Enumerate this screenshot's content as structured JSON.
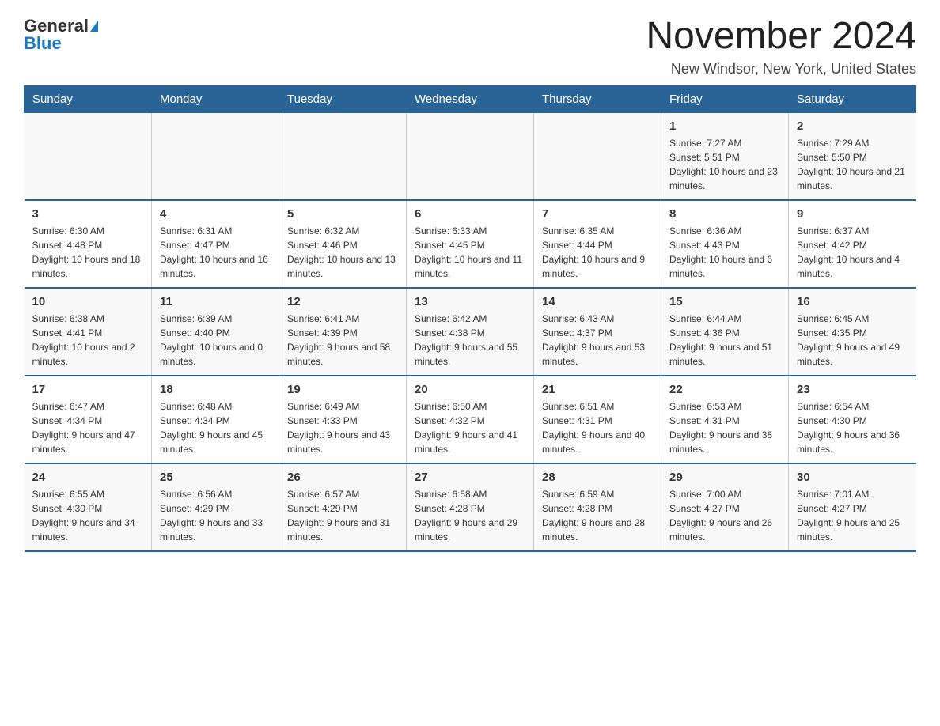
{
  "logo": {
    "general": "General",
    "blue": "Blue"
  },
  "title": "November 2024",
  "location": "New Windsor, New York, United States",
  "days_of_week": [
    "Sunday",
    "Monday",
    "Tuesday",
    "Wednesday",
    "Thursday",
    "Friday",
    "Saturday"
  ],
  "weeks": [
    [
      {
        "day": "",
        "info": ""
      },
      {
        "day": "",
        "info": ""
      },
      {
        "day": "",
        "info": ""
      },
      {
        "day": "",
        "info": ""
      },
      {
        "day": "",
        "info": ""
      },
      {
        "day": "1",
        "info": "Sunrise: 7:27 AM\nSunset: 5:51 PM\nDaylight: 10 hours and 23 minutes."
      },
      {
        "day": "2",
        "info": "Sunrise: 7:29 AM\nSunset: 5:50 PM\nDaylight: 10 hours and 21 minutes."
      }
    ],
    [
      {
        "day": "3",
        "info": "Sunrise: 6:30 AM\nSunset: 4:48 PM\nDaylight: 10 hours and 18 minutes."
      },
      {
        "day": "4",
        "info": "Sunrise: 6:31 AM\nSunset: 4:47 PM\nDaylight: 10 hours and 16 minutes."
      },
      {
        "day": "5",
        "info": "Sunrise: 6:32 AM\nSunset: 4:46 PM\nDaylight: 10 hours and 13 minutes."
      },
      {
        "day": "6",
        "info": "Sunrise: 6:33 AM\nSunset: 4:45 PM\nDaylight: 10 hours and 11 minutes."
      },
      {
        "day": "7",
        "info": "Sunrise: 6:35 AM\nSunset: 4:44 PM\nDaylight: 10 hours and 9 minutes."
      },
      {
        "day": "8",
        "info": "Sunrise: 6:36 AM\nSunset: 4:43 PM\nDaylight: 10 hours and 6 minutes."
      },
      {
        "day": "9",
        "info": "Sunrise: 6:37 AM\nSunset: 4:42 PM\nDaylight: 10 hours and 4 minutes."
      }
    ],
    [
      {
        "day": "10",
        "info": "Sunrise: 6:38 AM\nSunset: 4:41 PM\nDaylight: 10 hours and 2 minutes."
      },
      {
        "day": "11",
        "info": "Sunrise: 6:39 AM\nSunset: 4:40 PM\nDaylight: 10 hours and 0 minutes."
      },
      {
        "day": "12",
        "info": "Sunrise: 6:41 AM\nSunset: 4:39 PM\nDaylight: 9 hours and 58 minutes."
      },
      {
        "day": "13",
        "info": "Sunrise: 6:42 AM\nSunset: 4:38 PM\nDaylight: 9 hours and 55 minutes."
      },
      {
        "day": "14",
        "info": "Sunrise: 6:43 AM\nSunset: 4:37 PM\nDaylight: 9 hours and 53 minutes."
      },
      {
        "day": "15",
        "info": "Sunrise: 6:44 AM\nSunset: 4:36 PM\nDaylight: 9 hours and 51 minutes."
      },
      {
        "day": "16",
        "info": "Sunrise: 6:45 AM\nSunset: 4:35 PM\nDaylight: 9 hours and 49 minutes."
      }
    ],
    [
      {
        "day": "17",
        "info": "Sunrise: 6:47 AM\nSunset: 4:34 PM\nDaylight: 9 hours and 47 minutes."
      },
      {
        "day": "18",
        "info": "Sunrise: 6:48 AM\nSunset: 4:34 PM\nDaylight: 9 hours and 45 minutes."
      },
      {
        "day": "19",
        "info": "Sunrise: 6:49 AM\nSunset: 4:33 PM\nDaylight: 9 hours and 43 minutes."
      },
      {
        "day": "20",
        "info": "Sunrise: 6:50 AM\nSunset: 4:32 PM\nDaylight: 9 hours and 41 minutes."
      },
      {
        "day": "21",
        "info": "Sunrise: 6:51 AM\nSunset: 4:31 PM\nDaylight: 9 hours and 40 minutes."
      },
      {
        "day": "22",
        "info": "Sunrise: 6:53 AM\nSunset: 4:31 PM\nDaylight: 9 hours and 38 minutes."
      },
      {
        "day": "23",
        "info": "Sunrise: 6:54 AM\nSunset: 4:30 PM\nDaylight: 9 hours and 36 minutes."
      }
    ],
    [
      {
        "day": "24",
        "info": "Sunrise: 6:55 AM\nSunset: 4:30 PM\nDaylight: 9 hours and 34 minutes."
      },
      {
        "day": "25",
        "info": "Sunrise: 6:56 AM\nSunset: 4:29 PM\nDaylight: 9 hours and 33 minutes."
      },
      {
        "day": "26",
        "info": "Sunrise: 6:57 AM\nSunset: 4:29 PM\nDaylight: 9 hours and 31 minutes."
      },
      {
        "day": "27",
        "info": "Sunrise: 6:58 AM\nSunset: 4:28 PM\nDaylight: 9 hours and 29 minutes."
      },
      {
        "day": "28",
        "info": "Sunrise: 6:59 AM\nSunset: 4:28 PM\nDaylight: 9 hours and 28 minutes."
      },
      {
        "day": "29",
        "info": "Sunrise: 7:00 AM\nSunset: 4:27 PM\nDaylight: 9 hours and 26 minutes."
      },
      {
        "day": "30",
        "info": "Sunrise: 7:01 AM\nSunset: 4:27 PM\nDaylight: 9 hours and 25 minutes."
      }
    ]
  ]
}
